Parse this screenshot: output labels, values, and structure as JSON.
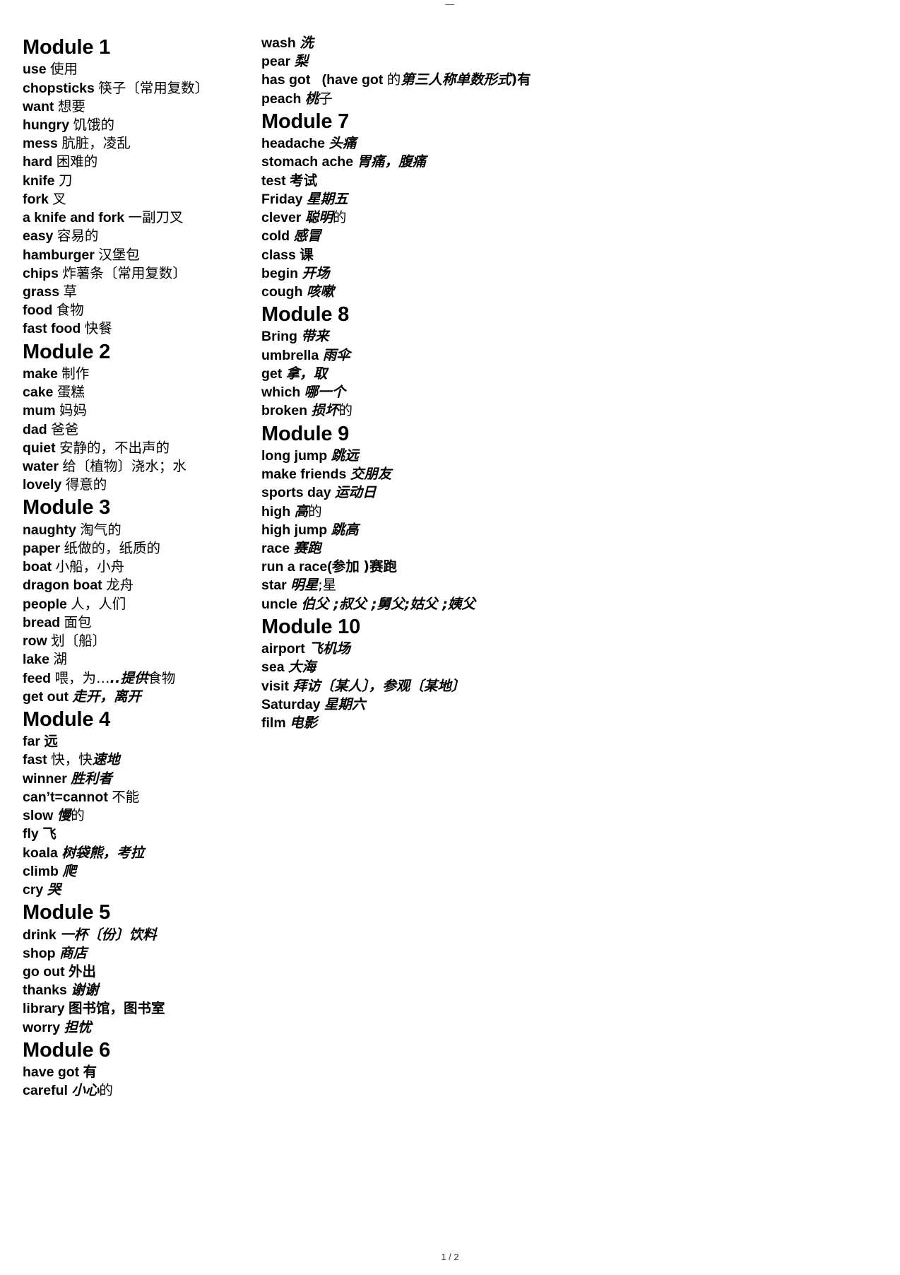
{
  "page": {
    "top_mark": "—",
    "footer": "1 / 2"
  },
  "left_column": [
    {
      "type": "module",
      "title": "Module 1"
    },
    {
      "type": "entry",
      "en": "use",
      "cn": "使用",
      "style": "plain"
    },
    {
      "type": "entry",
      "en": "chopsticks",
      "cn": "筷子〔常用复数〕",
      "style": "plain"
    },
    {
      "type": "entry",
      "en": "want",
      "cn": "想要",
      "style": "plain"
    },
    {
      "type": "entry",
      "en": "hungry",
      "cn": "饥饿的",
      "style": "plain"
    },
    {
      "type": "entry",
      "en": "mess",
      "cn": "肮脏，凌乱",
      "style": "plain"
    },
    {
      "type": "entry",
      "en": "hard",
      "cn": "困难的",
      "style": "plain"
    },
    {
      "type": "entry",
      "en": "knife",
      "cn": "刀",
      "style": "plain"
    },
    {
      "type": "entry",
      "en": "fork",
      "cn": "叉",
      "style": "plain"
    },
    {
      "type": "entry",
      "en": "a knife and fork",
      "cn": "一副刀叉",
      "style": "plain"
    },
    {
      "type": "entry",
      "en": "easy",
      "cn": "容易的",
      "style": "plain"
    },
    {
      "type": "entry",
      "en": "hamburger",
      "cn": "汉堡包",
      "style": "plain"
    },
    {
      "type": "entry",
      "en": "chips",
      "cn": "炸薯条〔常用复数〕",
      "style": "plain"
    },
    {
      "type": "entry",
      "en": "grass",
      "cn": "草",
      "style": "plain"
    },
    {
      "type": "entry",
      "en": "food",
      "cn": "食物",
      "style": "plain"
    },
    {
      "type": "entry",
      "en": "fast food",
      "cn": "快餐",
      "style": "plain"
    },
    {
      "type": "module",
      "title": "Module 2"
    },
    {
      "type": "entry",
      "en": "make",
      "cn": "制作",
      "style": "plain"
    },
    {
      "type": "entry",
      "en": "cake",
      "cn": "蛋糕",
      "style": "plain"
    },
    {
      "type": "entry",
      "en": "mum",
      "cn": "妈妈",
      "style": "plain"
    },
    {
      "type": "entry",
      "en": "dad",
      "cn": "爸爸",
      "style": "plain"
    },
    {
      "type": "entry",
      "en": "quiet",
      "cn": "安静的，不出声的",
      "style": "plain"
    },
    {
      "type": "entry",
      "en": "water",
      "cn": "给〔植物〕浇水；水",
      "style": "plain"
    },
    {
      "type": "entry",
      "en": "lovely",
      "cn": "得意的",
      "style": "plain"
    },
    {
      "type": "module",
      "title": "Module 3"
    },
    {
      "type": "entry",
      "en": "naughty",
      "cn": "淘气的",
      "style": "plain"
    },
    {
      "type": "entry",
      "en": "paper",
      "cn": "纸做的，纸质的",
      "style": "plain"
    },
    {
      "type": "entry",
      "en": "boat",
      "cn": "小船，小舟",
      "style": "plain"
    },
    {
      "type": "entry",
      "en": "dragon boat",
      "cn": "龙舟",
      "style": "plain"
    },
    {
      "type": "entry",
      "en": "people",
      "cn": "人，人们",
      "style": "plain"
    },
    {
      "type": "entry",
      "en": "bread",
      "cn": "面包",
      "style": "plain"
    },
    {
      "type": "entry",
      "en": "row",
      "cn": "划〔船〕",
      "style": "plain"
    },
    {
      "type": "entry",
      "en": "lake",
      "cn": "湖",
      "style": "plain"
    },
    {
      "type": "entry",
      "en": "feed",
      "cn": "喂，为…",
      "cn2": "..提供",
      "cn3": "食物",
      "style": "mixed-bi-mid"
    },
    {
      "type": "entry",
      "en": "get out",
      "cn": "走开，离开",
      "style": "bolditalic"
    },
    {
      "type": "module",
      "title": "Module 4"
    },
    {
      "type": "entry",
      "en": "far",
      "cn": "远",
      "style": "bold"
    },
    {
      "type": "entry",
      "en": "fast",
      "cn": "快，快",
      "cn2": "速地",
      "style": "mixed-tail-bi"
    },
    {
      "type": "entry",
      "en": "winner",
      "cn": "胜利者",
      "style": "bolditalic"
    },
    {
      "type": "entry",
      "en": "can’t=cannot",
      "cn": "不能",
      "style": "plain"
    },
    {
      "type": "entry",
      "en": "slow",
      "cn": "慢",
      "cn2": "的",
      "style": "mixed-head-bi"
    },
    {
      "type": "entry",
      "en": "fly",
      "cn": "飞",
      "style": "bold"
    },
    {
      "type": "entry",
      "en": "koala",
      "cn": "树袋熊，考拉",
      "style": "bolditalic"
    },
    {
      "type": "entry",
      "en": "climb",
      "cn": "爬",
      "style": "bolditalic"
    },
    {
      "type": "entry",
      "en": "cry",
      "cn": "哭",
      "style": "bolditalic"
    },
    {
      "type": "module",
      "title": "Module 5"
    },
    {
      "type": "entry",
      "en": "drink",
      "cn": "一杯〔份〕饮料",
      "style": "bolditalic"
    },
    {
      "type": "entry",
      "en": "shop",
      "cn": "商店",
      "style": "bolditalic"
    },
    {
      "type": "entry",
      "en": "go out",
      "cn": "外出",
      "style": "bold"
    },
    {
      "type": "entry",
      "en": "thanks",
      "cn": "谢谢",
      "style": "bolditalic"
    },
    {
      "type": "entry",
      "en": "library",
      "cn": "图书馆，图书室",
      "style": "bold"
    },
    {
      "type": "entry",
      "en": "worry",
      "cn": "担忧",
      "style": "bolditalic"
    },
    {
      "type": "module",
      "title": "Module 6"
    },
    {
      "type": "entry",
      "en": "have got",
      "cn": "有",
      "style": "bold"
    },
    {
      "type": "entry",
      "en": "careful",
      "cn": "小心的",
      "style": "mixed-head-bi-2"
    }
  ],
  "right_column": [
    {
      "type": "entry",
      "en": "wash",
      "cn": "洗",
      "style": "bolditalic"
    },
    {
      "type": "entry",
      "en": "pear",
      "cn": "梨",
      "style": "bolditalic"
    },
    {
      "type": "entry",
      "en": "has got",
      "cn": "(have got",
      "cn2": "的",
      "cn3": "第三人称单数形式",
      "cn4": ")有",
      "style": "hasgot"
    },
    {
      "type": "entry",
      "en": "peach",
      "cn": "桃",
      "cn2": "子",
      "style": "mixed-head-bi"
    },
    {
      "type": "module",
      "title": "Module 7"
    },
    {
      "type": "entry",
      "en": "headache",
      "cn": "头痛",
      "style": "bolditalic"
    },
    {
      "type": "entry",
      "en": "stomach ache",
      "cn": "胃痛，腹痛",
      "style": "bolditalic"
    },
    {
      "type": "entry",
      "en": "test",
      "cn": "考试",
      "style": "bold"
    },
    {
      "type": "entry",
      "en": "Friday",
      "cn": "星期五",
      "style": "bolditalic"
    },
    {
      "type": "entry",
      "en": "clever",
      "cn": "聪明",
      "cn2": "的",
      "style": "mixed-head-bi"
    },
    {
      "type": "entry",
      "en": "cold",
      "cn": "感冒",
      "style": "bolditalic"
    },
    {
      "type": "entry",
      "en": "class",
      "cn": "课",
      "style": "bold"
    },
    {
      "type": "entry",
      "en": "begin",
      "cn": "开场",
      "style": "bolditalic"
    },
    {
      "type": "entry",
      "en": "cough",
      "cn": "咳嗽",
      "style": "bolditalic"
    },
    {
      "type": "module",
      "title": "Module 8"
    },
    {
      "type": "entry",
      "en": "Bring",
      "cn": "带来",
      "style": "bolditalic"
    },
    {
      "type": "entry",
      "en": "umbrella",
      "cn": "雨伞",
      "style": "bolditalic"
    },
    {
      "type": "entry",
      "en": "get",
      "cn": "拿，取",
      "style": "bolditalic"
    },
    {
      "type": "entry",
      "en": "which",
      "cn": "哪一个",
      "style": "bolditalic"
    },
    {
      "type": "entry",
      "en": "broken",
      "cn": "损坏",
      "cn2": "的",
      "style": "mixed-head-bi"
    },
    {
      "type": "module",
      "title": "Module 9"
    },
    {
      "type": "entry",
      "en": "long jump",
      "cn": "跳远",
      "style": "bolditalic"
    },
    {
      "type": "entry",
      "en": "make friends",
      "cn": "交朋友",
      "style": "bolditalic"
    },
    {
      "type": "entry",
      "en": "sports day",
      "cn": "运动日",
      "style": "bolditalic"
    },
    {
      "type": "entry",
      "en": "high",
      "cn": "高",
      "cn2": "的",
      "style": "mixed-head-bi"
    },
    {
      "type": "entry",
      "en": "high jump",
      "cn": "跳高",
      "style": "bolditalic"
    },
    {
      "type": "entry",
      "en": "race",
      "cn": "赛跑",
      "style": "bolditalic"
    },
    {
      "type": "entry",
      "en": "run a race(参加",
      "cn": ")赛跑",
      "style": "runarace"
    },
    {
      "type": "entry",
      "en": "star",
      "cn": "明星",
      "cn2": ";星",
      "style": "mixed-head-bi"
    },
    {
      "type": "entry",
      "en": "uncle",
      "cn": "伯父 ;叔父 ;舅父;姑父 ;姨父",
      "style": "bolditalic"
    },
    {
      "type": "module",
      "title": "Module 10"
    },
    {
      "type": "entry",
      "en": "airport",
      "cn": "飞机场",
      "style": "bolditalic"
    },
    {
      "type": "entry",
      "en": "sea",
      "cn": "大海",
      "style": "bolditalic"
    },
    {
      "type": "entry",
      "en": "visit",
      "cn": "拜访〔某人〕，参观〔某地〕",
      "style": "bolditalic"
    },
    {
      "type": "entry",
      "en": "Saturday",
      "cn": "星期六",
      "style": "bolditalic"
    },
    {
      "type": "entry",
      "en": "film",
      "cn": "电影",
      "style": "bolditalic"
    }
  ]
}
